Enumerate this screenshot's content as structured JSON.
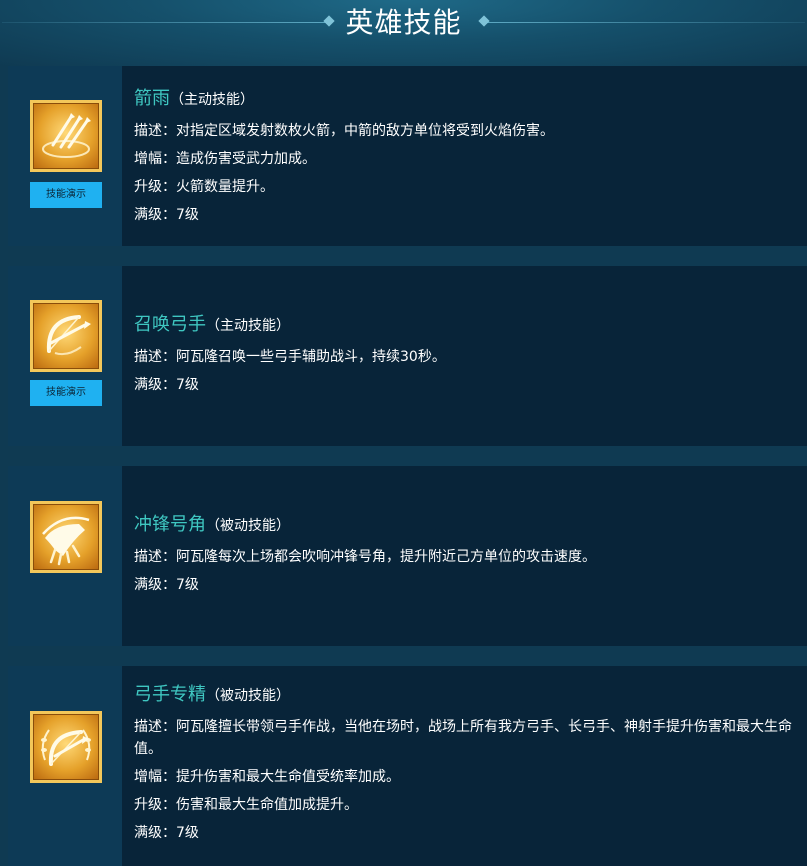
{
  "header": {
    "title": "英雄技能"
  },
  "skills": [
    {
      "name": "箭雨",
      "type": "（主动技能）",
      "demo_label": "技能演示",
      "icon": "arrow-rain-icon",
      "lines": [
        "描述：对指定区域发射数枚火箭，中箭的敌方单位将受到火焰伤害。",
        "增幅：造成伤害受武力加成。",
        "升级：火箭数量提升。",
        "满级：7级"
      ]
    },
    {
      "name": "召唤弓手",
      "type": "（主动技能）",
      "demo_label": "技能演示",
      "icon": "summon-archer-bow-icon",
      "lines": [
        "描述：阿瓦隆召唤一些弓手辅助战斗，持续30秒。",
        "满级：7级"
      ]
    },
    {
      "name": "冲锋号角",
      "type": "（被动技能）",
      "icon": "charge-horn-icon",
      "lines": [
        "描述：阿瓦隆每次上场都会吹响冲锋号角，提升附近己方单位的攻击速度。",
        "满级：7级"
      ]
    },
    {
      "name": "弓手专精",
      "type": "（被动技能）",
      "icon": "archer-mastery-bow-icon",
      "lines": [
        "描述：阿瓦隆擅长带领弓手作战，当他在场时，战场上所有我方弓手、长弓手、神射手提升伤害和最大生命值。",
        "增幅：提升伤害和最大生命值受统率加成。",
        "升级：伤害和最大生命值加成提升。",
        "满级：7级"
      ]
    }
  ]
}
